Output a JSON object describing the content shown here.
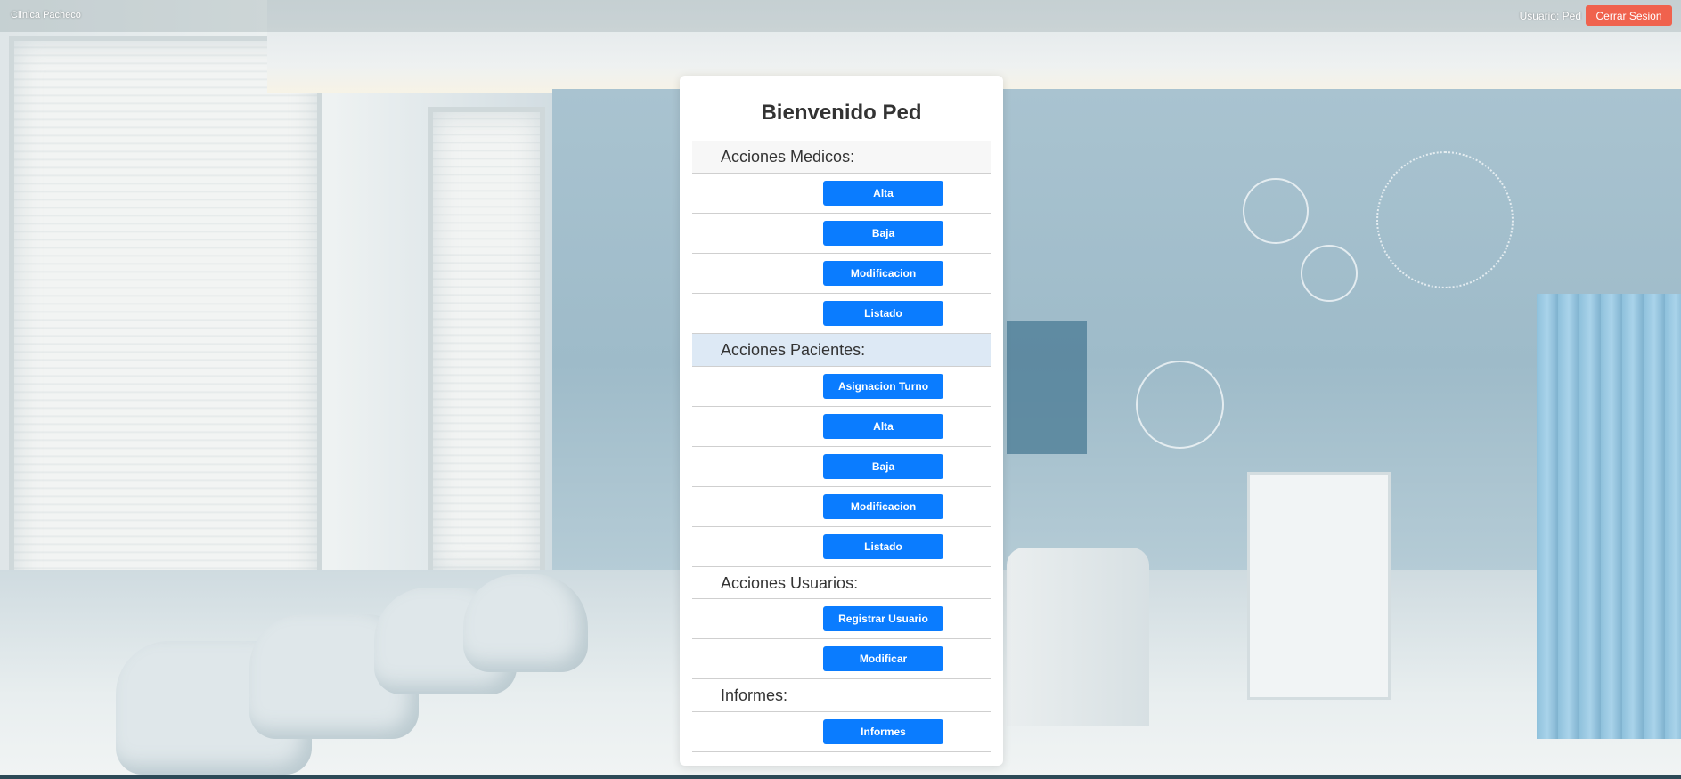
{
  "header": {
    "brand": "Clinica Pacheco",
    "user_label": "Usuario: Ped",
    "logout_label": "Cerrar Sesion"
  },
  "card": {
    "title": "Bienvenido Ped",
    "sections": {
      "medicos": {
        "label": "Acciones Medicos:",
        "buttons": [
          "Alta",
          "Baja",
          "Modificacion",
          "Listado"
        ]
      },
      "pacientes": {
        "label": "Acciones Pacientes:",
        "buttons": [
          "Asignacion Turno",
          "Alta",
          "Baja",
          "Modificacion",
          "Listado"
        ]
      },
      "usuarios": {
        "label": "Acciones Usuarios:",
        "buttons": [
          "Registrar Usuario",
          "Modificar"
        ]
      },
      "informes": {
        "label": "Informes:",
        "buttons": [
          "Informes"
        ]
      }
    }
  },
  "colors": {
    "primary_button": "#0a7cff",
    "logout_button": "#f0624d",
    "highlight_row": "#dde9f5"
  }
}
